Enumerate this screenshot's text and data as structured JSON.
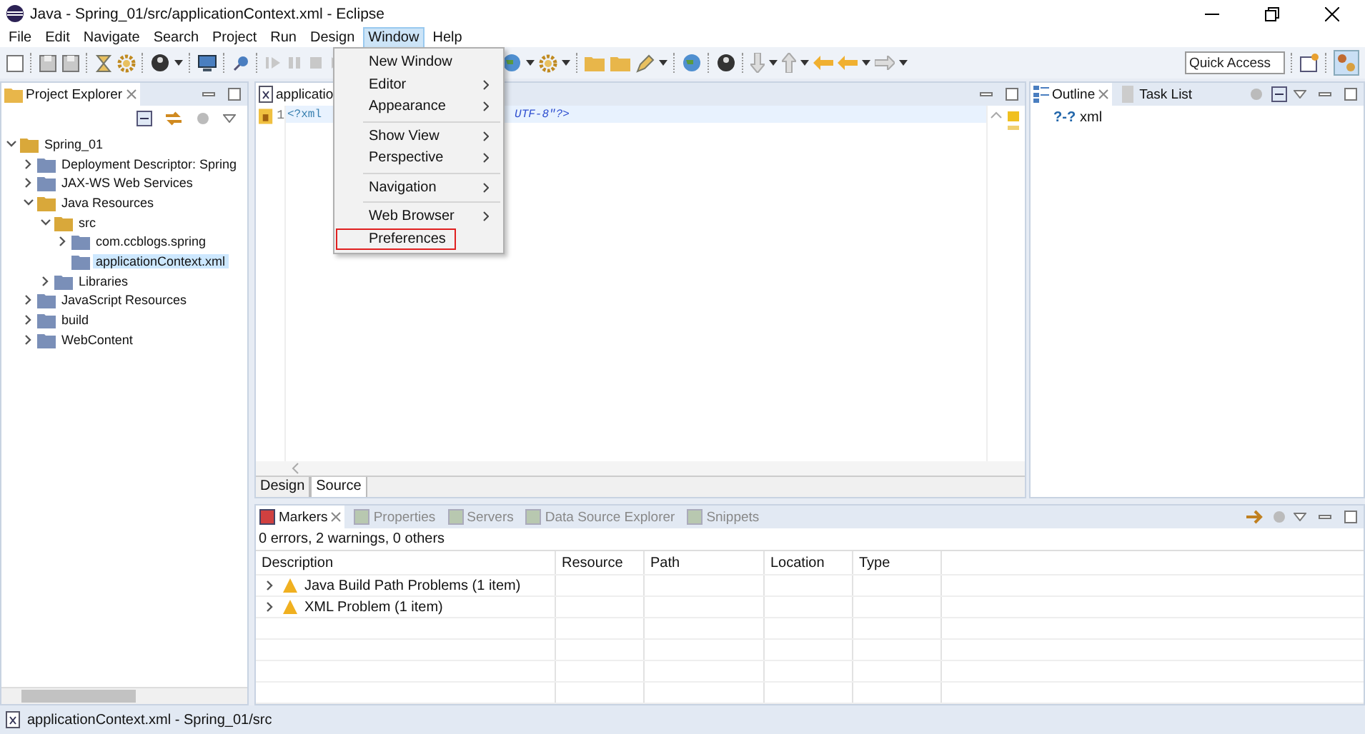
{
  "window": {
    "title": "Java - Spring_01/src/applicationContext.xml - Eclipse"
  },
  "menubar": [
    {
      "label": "File",
      "selected": false
    },
    {
      "label": "Edit",
      "selected": false
    },
    {
      "label": "Navigate",
      "selected": false
    },
    {
      "label": "Search",
      "selected": false
    },
    {
      "label": "Project",
      "selected": false
    },
    {
      "label": "Run",
      "selected": false
    },
    {
      "label": "Design",
      "selected": false
    },
    {
      "label": "Window",
      "selected": true
    },
    {
      "label": "Help",
      "selected": false
    }
  ],
  "window_menu": {
    "groups": [
      [
        {
          "label": "New Window",
          "submenu": false,
          "highlighted": false
        },
        {
          "label": "Editor",
          "submenu": true,
          "highlighted": false
        },
        {
          "label": "Appearance",
          "submenu": true,
          "highlighted": false
        }
      ],
      [
        {
          "label": "Show View",
          "submenu": true,
          "highlighted": false
        },
        {
          "label": "Perspective",
          "submenu": true,
          "highlighted": false
        }
      ],
      [
        {
          "label": "Navigation",
          "submenu": true,
          "highlighted": false
        }
      ],
      [
        {
          "label": "Web Browser",
          "submenu": true,
          "highlighted": false
        },
        {
          "label": "Preferences",
          "submenu": false,
          "highlighted": true
        }
      ]
    ]
  },
  "quick_access": {
    "placeholder": "Quick Access"
  },
  "project_explorer": {
    "title": "Project Explorer",
    "tree": [
      {
        "label": "Spring_01",
        "expanded": true,
        "selected": false,
        "children": [
          {
            "label": "Deployment Descriptor: Spring",
            "expanded": false,
            "selected": false
          },
          {
            "label": "JAX-WS Web Services",
            "expanded": false,
            "selected": false
          },
          {
            "label": "Java Resources",
            "expanded": true,
            "selected": false,
            "children": [
              {
                "label": "src",
                "expanded": true,
                "selected": false,
                "children": [
                  {
                    "label": "com.ccblogs.spring",
                    "expanded": false,
                    "selected": false
                  },
                  {
                    "label": "applicationContext.xml",
                    "selected": true
                  }
                ]
              },
              {
                "label": "Libraries",
                "expanded": false,
                "selected": false
              }
            ]
          },
          {
            "label": "JavaScript Resources",
            "expanded": false,
            "selected": false
          },
          {
            "label": "build",
            "expanded": false,
            "selected": false
          },
          {
            "label": "WebContent",
            "expanded": false,
            "selected": false
          }
        ]
      }
    ]
  },
  "editor": {
    "tab": "applicatio",
    "line_number": "1",
    "code_start": "<?xml",
    "code_end": "UTF-8\"?>",
    "bottom_tabs": [
      {
        "label": "Design",
        "selected": false
      },
      {
        "label": "Source",
        "selected": true
      }
    ]
  },
  "outline": {
    "tabs": [
      {
        "label": "Outline",
        "selected": true
      },
      {
        "label": "Task List",
        "selected": false
      }
    ],
    "items": [
      {
        "marker": "?-?",
        "label": "xml"
      }
    ]
  },
  "markers": {
    "tabs": [
      {
        "label": "Markers",
        "selected": true
      },
      {
        "label": "Properties",
        "selected": false
      },
      {
        "label": "Servers",
        "selected": false
      },
      {
        "label": "Data Source Explorer",
        "selected": false
      },
      {
        "label": "Snippets",
        "selected": false
      }
    ],
    "summary": "0 errors, 2 warnings, 0 others",
    "columns": [
      "Description",
      "Resource",
      "Path",
      "Location",
      "Type"
    ],
    "rows": [
      {
        "description": "Java Build Path Problems (1 item)",
        "expanded": false
      },
      {
        "description": "XML Problem (1 item)",
        "expanded": false
      }
    ]
  },
  "status_bar": {
    "text": "applicationContext.xml - Spring_01/src"
  }
}
